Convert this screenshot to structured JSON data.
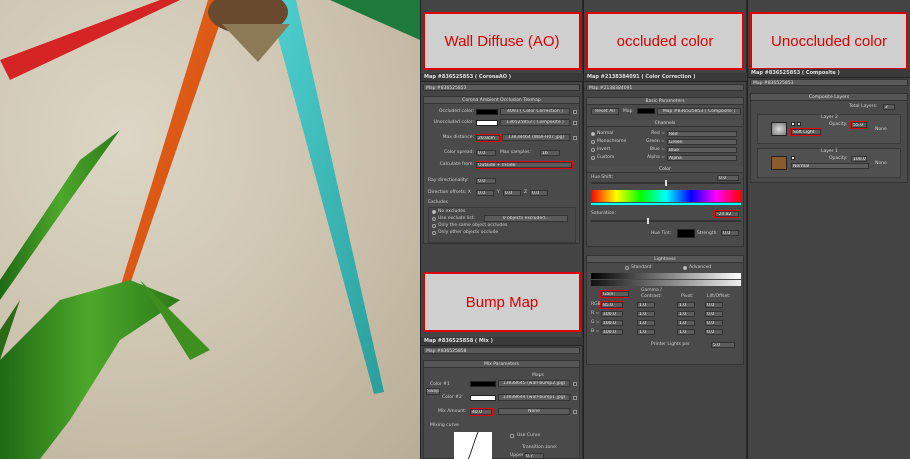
{
  "labels": {
    "wall_diffuse": "Wall Diffuse (AO)",
    "occluded": "occluded color",
    "unoccluded": "Unoccluded color",
    "bump": "Bump Map"
  },
  "ao_panel": {
    "title": "Map #836525853 ( CoronaAO )",
    "mapname": "Map #836525853",
    "rollout": "Corona Ambient Occlusion Texmap",
    "occluded_label": "Occluded color:",
    "occluded_map": "4091 ( Color Correction )",
    "unoccluded_label": "Unoccluded color:",
    "unoccluded_map": "136525853 ( Composite )",
    "maxdist_label": "Max distance:",
    "maxdist_value": "20.0cm",
    "maxdist_map": "13838464 (Wall-H07.jpg)",
    "spread_label": "Color spread:",
    "spread_value": "0.0",
    "samples_label": "Max samples:",
    "samples_value": "16",
    "calc_label": "Calculate from:",
    "calc_value": "Outside + Inside",
    "raydir_label": "Ray directionality:",
    "raydir_value": "0.0",
    "diroff_label": "Direction offsets: X",
    "diroff_x": "0.0",
    "diroff_y_label": "Y",
    "diroff_y": "0.0",
    "diroff_z_label": "Z",
    "diroff_z": "0.0",
    "excludes_label": "Excludes",
    "excl_options": [
      "No excludes",
      "Use exclude list:",
      "Only the same object occludes",
      "Only other objects occlude"
    ],
    "excl_count": "0 objects excluded..."
  },
  "mix_panel": {
    "title": "Map #836525858 ( Mix )",
    "mapname": "Map #836525858",
    "rollout": "Mix Parameters",
    "maps_label": "Maps",
    "swap": "Swap",
    "color1_label": "Color #1",
    "color1_map": "13838645 (wall-bump2.jpg)",
    "color2_label": "Color #2",
    "color2_map": "13838644 (wall-bump1.jpg)",
    "mixamount_label": "Mix Amount:",
    "mixamount_value": "40.0",
    "mixamount_map": "None",
    "curve_label": "Mixing curve",
    "usecurve": "Use Curve",
    "transition": "Transition zone:",
    "upper_label": "Upper:",
    "upper_value": "0.7"
  },
  "cc_panel": {
    "title": "Map #2138384091 ( Color Correction )",
    "mapname": "Map #2138384091",
    "basic": "Basic Parameters",
    "reset": "Reset All",
    "map_label": "Map",
    "map_value": "Map #836525853 ( Composite )",
    "channels": "Channels",
    "normal": "Normal",
    "mono": "Monochrome",
    "invert": "Invert",
    "custom": "Custom",
    "red_label": "Red =",
    "red": "Red",
    "green_label": "Green =",
    "green": "Green",
    "blue_label": "Blue =",
    "blue": "Blue",
    "alpha_label": "Alpha =",
    "alpha": "Alpha",
    "color": "Color",
    "hue_shift": "Hue Shift:",
    "hue_value": "0.0",
    "saturation": "Saturation:",
    "sat_value": "-20.82",
    "hue_tint": "Hue Tint:",
    "strength": "Strength:",
    "strength_value": "0.0",
    "lightness": "Lightness",
    "standard": "Standard",
    "advanced": "Advanced",
    "gain": "Gain:",
    "gamma": "Gamma /",
    "contrast": "Contrast:",
    "pivot": "Pivot:",
    "lift": "Lift/Offset:",
    "rows": [
      {
        "ch": "RGB =",
        "gain": "85.0",
        "gamma": "1.0",
        "pivot": "1.0",
        "lift": "0.0"
      },
      {
        "ch": "R =",
        "gain": "100.0",
        "gamma": "1.0",
        "pivot": "1.0",
        "lift": "0.0"
      },
      {
        "ch": "G =",
        "gain": "100.0",
        "gamma": "1.0",
        "pivot": "1.0",
        "lift": "0.0"
      },
      {
        "ch": "B =",
        "gain": "100.0",
        "gamma": "1.0",
        "pivot": "1.0",
        "lift": "0.0"
      }
    ],
    "printer": "Printer Lights per",
    "printer_value": "5.0"
  },
  "comp_panel": {
    "title": "Map #836525853 ( Composite )",
    "mapname": "Map #836525853",
    "rollout": "Composite Layers",
    "total_label": "Total Layers:",
    "total_value": "2",
    "layer2": "Layer 2",
    "opacity_label": "Opacity:",
    "layer2_opacity": "55.0",
    "layer2_blend": "Soft Light",
    "none": "None",
    "layer1": "Layer 1",
    "layer1_opacity": "100.0",
    "layer1_blend": "Normal"
  }
}
